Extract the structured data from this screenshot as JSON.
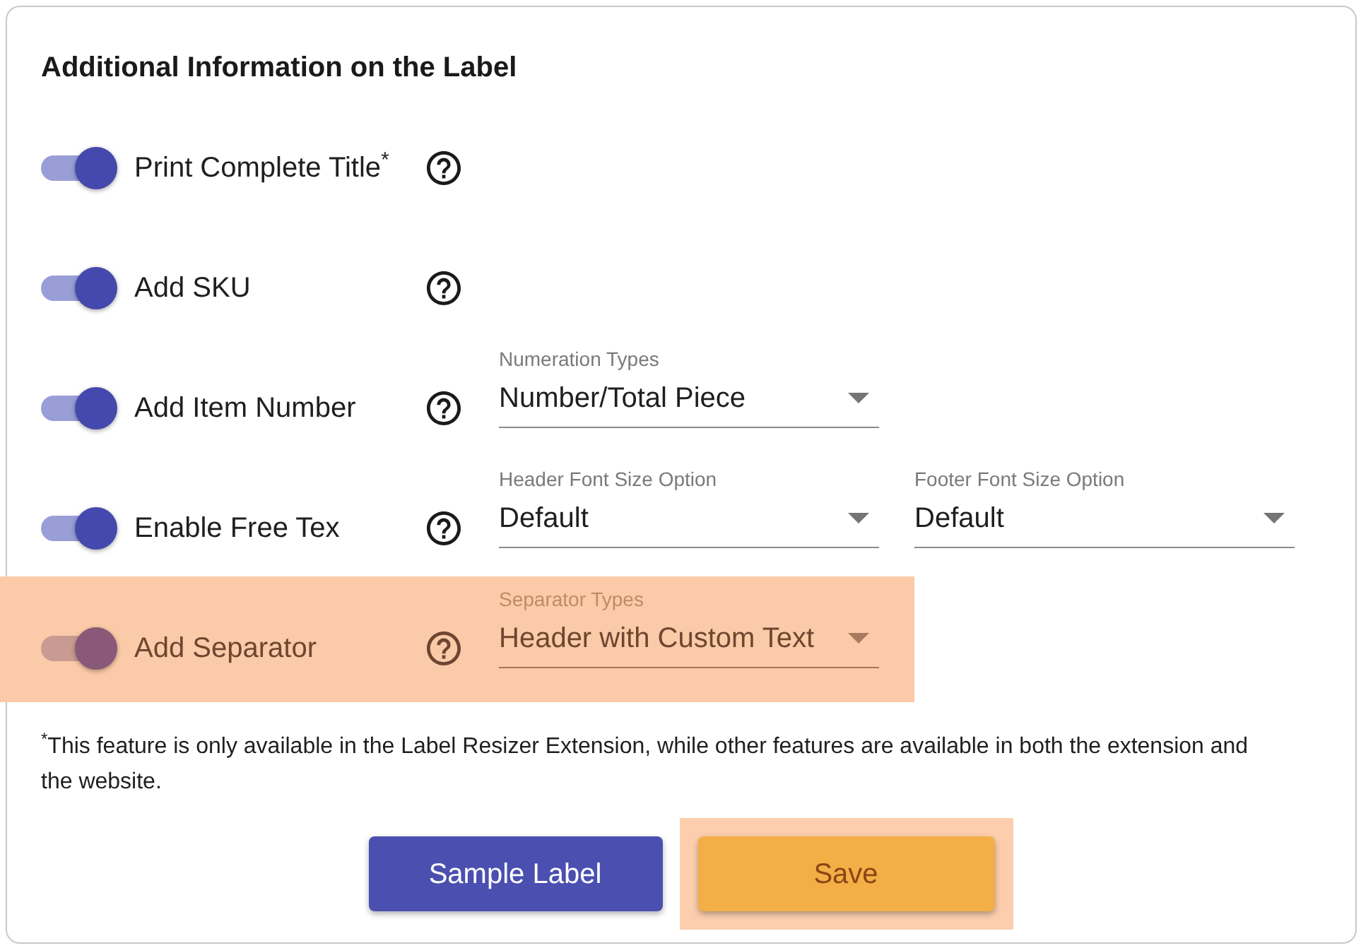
{
  "panel": {
    "title": "Additional Information on the Label"
  },
  "options": [
    {
      "label": "Print Complete Title$^{*}$",
      "on": true,
      "highlighted": false
    },
    {
      "label": "Add SKU",
      "on": true,
      "highlighted": false
    },
    {
      "label": "Add Item Number",
      "on": true,
      "highlighted": false,
      "selects": [
        {
          "label": "Numeration Types",
          "value": "Number/Total Piece"
        }
      ]
    },
    {
      "label": "Enable Free Tex",
      "on": true,
      "highlighted": false,
      "selects": [
        {
          "label": "Header Font Size Option",
          "value": "Default"
        },
        {
          "label": "Footer Font Size Option",
          "value": "Default"
        }
      ]
    },
    {
      "label": "Add Separator",
      "on": true,
      "highlighted": true,
      "selects": [
        {
          "label": "Separator Types",
          "value": "Header with Custom Text"
        }
      ]
    }
  ],
  "footnote": "$^{*}$This feature is only available in the Label Resizer Extension, while other features are available in both the extension and the website.",
  "buttons": [
    {
      "label": "Sample Label",
      "kind": "primary",
      "highlighted": false
    },
    {
      "label": "Save",
      "kind": "accent",
      "highlighted": true
    }
  ]
}
